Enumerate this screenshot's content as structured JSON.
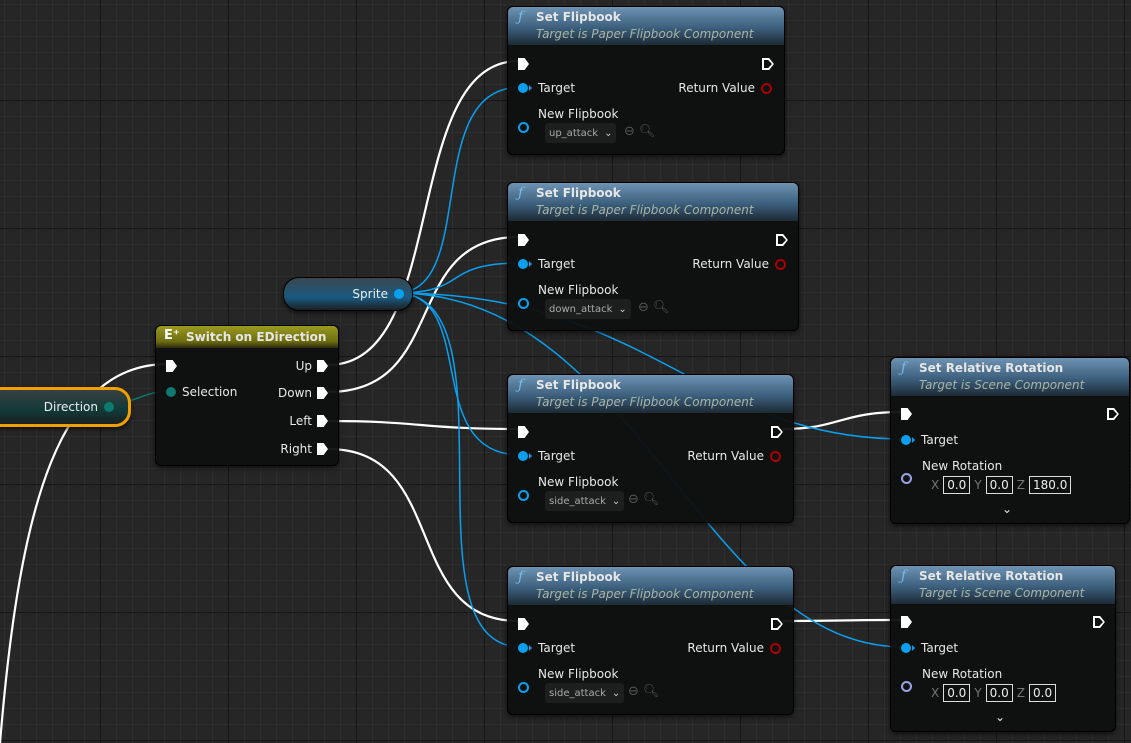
{
  "colors": {
    "exec_wire": "#ffffff",
    "object_wire": "#0aa0f0",
    "enum_wire": "#0c7a6e",
    "function_header": "#3b5f7c",
    "switch_header": "#8a8a1a",
    "selected_outline": "#f0a000"
  },
  "variables": {
    "sprite": {
      "label": "Sprite",
      "icon": "object-pin"
    },
    "direction": {
      "label": "Direction",
      "icon": "enum-pin",
      "selected": true
    }
  },
  "switch_node": {
    "title": "Switch on EDirection",
    "icon": "enum-switch-icon",
    "input_selection": "Selection",
    "outputs": [
      "Up",
      "Down",
      "Left",
      "Right"
    ]
  },
  "set_flipbook_nodes": [
    {
      "title": "Set Flipbook",
      "subtitle": "Target is Paper Flipbook Component",
      "target": "Target",
      "return_value": "Return Value",
      "param": "New Flipbook",
      "value": "up_attack"
    },
    {
      "title": "Set Flipbook",
      "subtitle": "Target is Paper Flipbook Component",
      "target": "Target",
      "return_value": "Return Value",
      "param": "New Flipbook",
      "value": "down_attack"
    },
    {
      "title": "Set Flipbook",
      "subtitle": "Target is Paper Flipbook Component",
      "target": "Target",
      "return_value": "Return Value",
      "param": "New Flipbook",
      "value": "side_attack"
    },
    {
      "title": "Set Flipbook",
      "subtitle": "Target is Paper Flipbook Component",
      "target": "Target",
      "return_value": "Return Value",
      "param": "New Flipbook",
      "value": "side_attack"
    }
  ],
  "set_rotation_nodes": [
    {
      "title": "Set Relative Rotation",
      "subtitle": "Target is Scene Component",
      "target": "Target",
      "param": "New Rotation",
      "x_label": "X",
      "y_label": "Y",
      "z_label": "Z",
      "x": "0.0",
      "y": "0.0",
      "z": "180.0"
    },
    {
      "title": "Set Relative Rotation",
      "subtitle": "Target is Scene Component",
      "target": "Target",
      "param": "New Rotation",
      "x_label": "X",
      "y_label": "Y",
      "z_label": "Z",
      "x": "0.0",
      "y": "0.0",
      "z": "0.0"
    }
  ]
}
